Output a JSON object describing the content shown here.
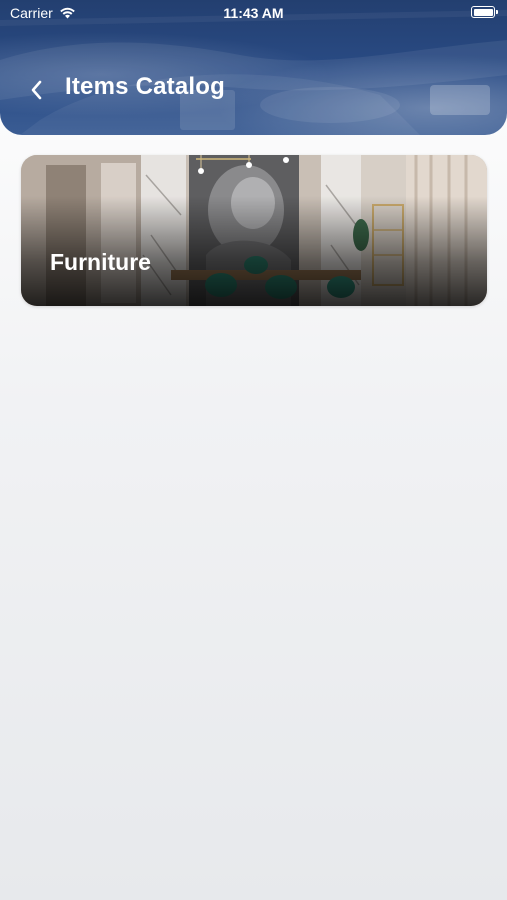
{
  "status_bar": {
    "carrier": "Carrier",
    "time": "11:43 AM",
    "wifi_icon": "wifi-icon",
    "battery_icon": "battery-icon"
  },
  "header": {
    "title": "Items Catalog",
    "back_icon": "chevron-left-icon"
  },
  "categories": [
    {
      "label": "Furniture"
    }
  ],
  "colors": {
    "header_top": "#233f70",
    "header_bottom": "#3a5c93",
    "background": "#eef0f2",
    "text_on_dark": "#ffffff"
  }
}
